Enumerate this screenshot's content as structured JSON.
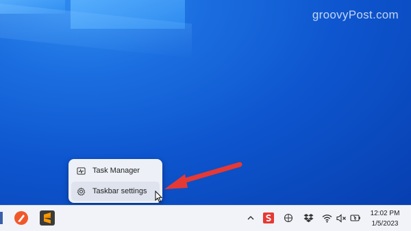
{
  "watermark": "groovyPost.com",
  "context_menu": {
    "items": [
      {
        "label": "Task Manager",
        "icon": "task-manager-icon"
      },
      {
        "label": "Taskbar settings",
        "icon": "gear-icon"
      }
    ]
  },
  "taskbar": {
    "apps": [
      {
        "name": "app-partial-icon"
      },
      {
        "name": "brave-pen-app-icon",
        "color": "#f0582a"
      },
      {
        "name": "sublime-text-icon",
        "color": "#ff9800"
      }
    ],
    "tray": {
      "icons": [
        "chevron-up-icon",
        "snagit-icon",
        "settings-tray-icon",
        "dropbox-icon",
        "wifi-icon",
        "volume-muted-icon",
        "battery-icon"
      ]
    },
    "clock": {
      "time": "12:02 PM",
      "date": "1/5/2023"
    }
  },
  "colors": {
    "annotation_arrow": "#e53935",
    "desktop": "#0a4fc4"
  }
}
